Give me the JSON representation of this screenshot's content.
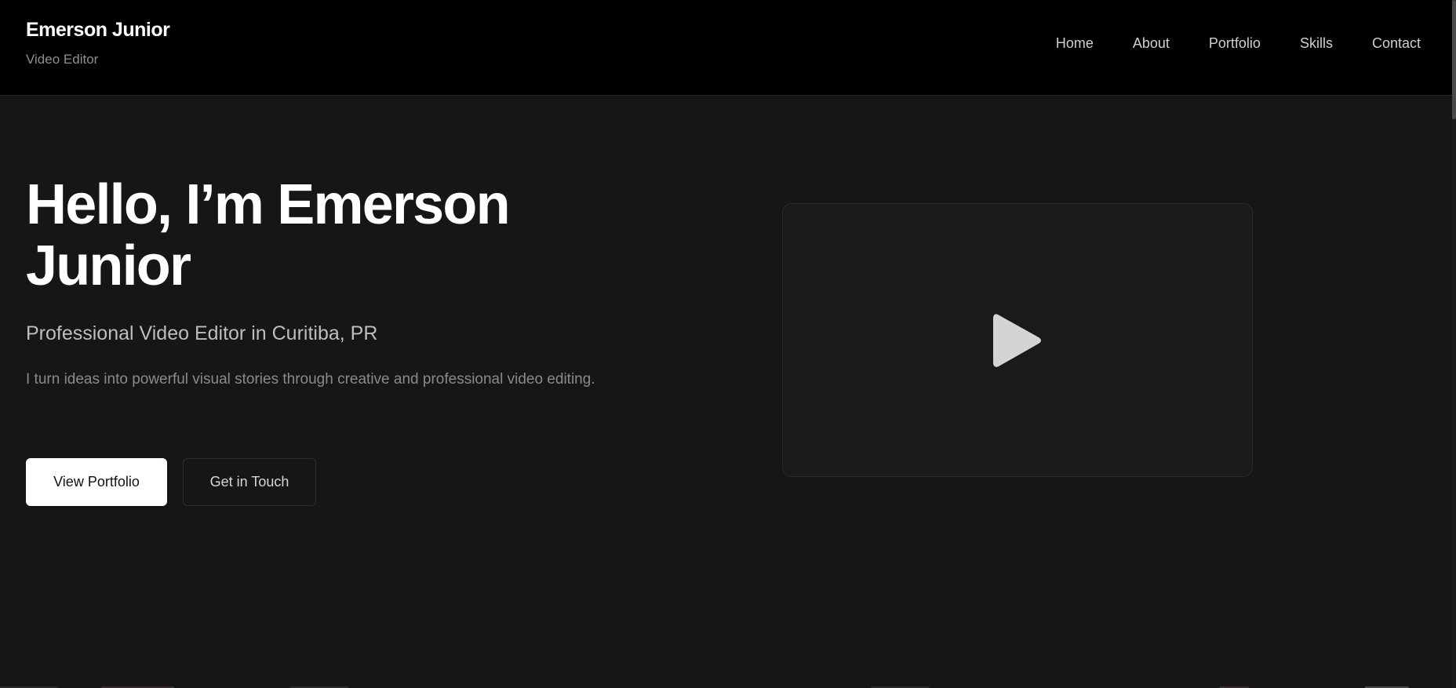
{
  "header": {
    "brand_name": "Emerson Junior",
    "brand_role": "Video Editor",
    "nav": [
      "Home",
      "About",
      "Portfolio",
      "Skills",
      "Contact"
    ]
  },
  "hero": {
    "title": "Hello, I’m Emerson Junior",
    "subtitle": "Professional Video Editor in Curitiba, PR",
    "description": "I turn ideas into powerful visual stories through creative and professional video editing.",
    "primary_button": "View Portfolio",
    "secondary_button": "Get in Touch"
  },
  "video": {
    "icon": "play-icon"
  },
  "colors": {
    "header_bg": "#000000",
    "page_bg": "#161616",
    "card_bg": "#1a1a1b",
    "primary_text": "#ffffff",
    "muted_text": "#8a8a8a",
    "play_icon": "#d4d4d4"
  }
}
